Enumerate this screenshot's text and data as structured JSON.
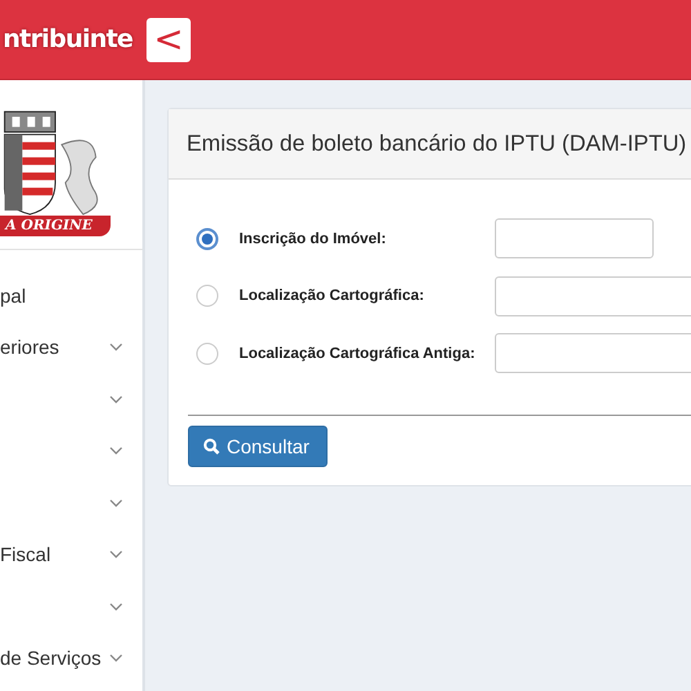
{
  "header": {
    "title": "ntribuinte",
    "toggle": "<"
  },
  "logo": {
    "motto": "A ORIGINE"
  },
  "sidebar": {
    "items": [
      {
        "label": "pal",
        "expandable": false
      },
      {
        "label": "eriores",
        "expandable": true
      },
      {
        "expandable": true
      },
      {
        "expandable": true
      },
      {
        "expandable": true
      },
      {
        "label": "Fiscal",
        "expandable": true
      },
      {
        "expandable": true
      },
      {
        "label": "de Serviços",
        "expandable": true
      }
    ]
  },
  "panel": {
    "title": "Emissão de boleto bancário do IPTU (DAM-IPTU)",
    "options": [
      {
        "label": "Inscrição do Imóvel:",
        "selected": true,
        "kind": "short"
      },
      {
        "label": "Localização Cartográfica:",
        "selected": false,
        "kind": "wide"
      },
      {
        "label": "Localização Cartográfica Antiga:",
        "selected": false,
        "kind": "wide"
      }
    ],
    "button": "Consultar"
  }
}
